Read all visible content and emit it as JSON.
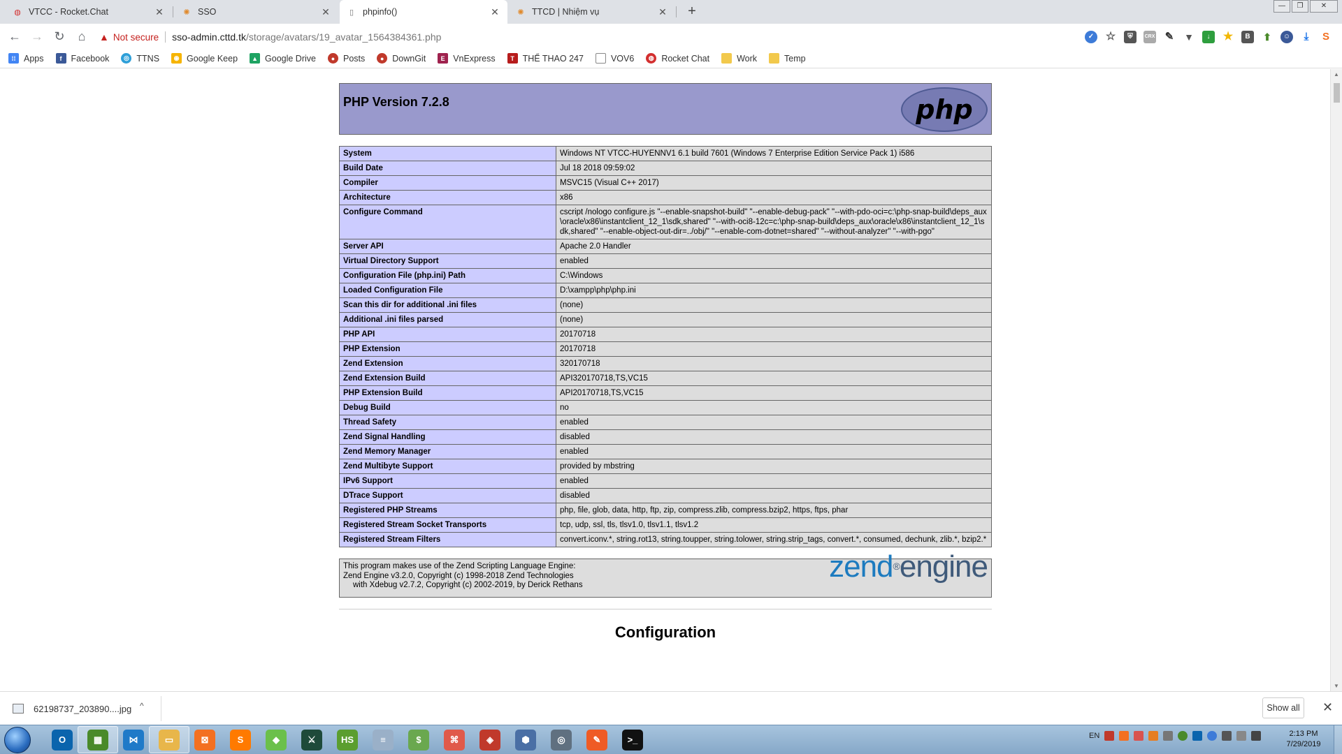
{
  "browser": {
    "tabs": [
      {
        "title": "VTCC - Rocket.Chat",
        "icon": "rocket-chat-icon",
        "active": false
      },
      {
        "title": "SSO",
        "icon": "sso-icon",
        "active": false
      },
      {
        "title": "phpinfo()",
        "icon": "page-icon",
        "active": true
      },
      {
        "title": "TTCD | Nhiệm vụ",
        "icon": "ttcd-icon",
        "active": false
      }
    ],
    "new_tab": "+",
    "window_controls": {
      "minimize": "—",
      "restore": "❐",
      "close": "✕"
    },
    "nav": {
      "back": "←",
      "forward": "→",
      "reload": "↻",
      "home": "⌂"
    },
    "address": {
      "security_label": "Not secure",
      "host": "sso-admin.cttd.tk",
      "path": "/storage/avatars/19_avatar_1564384361.php"
    },
    "extensions": [
      "lastpass-icon",
      "bookmark-star-icon",
      "shield-extension-icon",
      "crx-icon",
      "dropper-icon",
      "vpn-icon",
      "download-helper-icon",
      "star-extension-icon",
      "b-extension-icon",
      "arrow-up-extension-icon",
      "profile-avatar-icon",
      "downloads-icon",
      "menu-extension-icon"
    ],
    "bookmarks": [
      {
        "label": "Apps",
        "icon": "apps-grid-icon",
        "color": "#4285f4"
      },
      {
        "label": "Facebook",
        "icon": "facebook-icon",
        "color": "#3b5998"
      },
      {
        "label": "TTNS",
        "icon": "globe-icon",
        "color": "#2e9fd8"
      },
      {
        "label": "Google Keep",
        "icon": "google-keep-icon",
        "color": "#f6b400"
      },
      {
        "label": "Google Drive",
        "icon": "google-drive-icon",
        "color": "#1ea362"
      },
      {
        "label": "Posts",
        "icon": "posts-icon",
        "color": "#c0392b"
      },
      {
        "label": "DownGit",
        "icon": "downgit-icon",
        "color": "#c0392b"
      },
      {
        "label": "VnExpress",
        "icon": "vnexpress-icon",
        "color": "#9f224e"
      },
      {
        "label": "THỂ THAO 247",
        "icon": "thethao-icon",
        "color": "#b71c1c"
      },
      {
        "label": "VOV6",
        "icon": "page-icon",
        "color": "#888888"
      },
      {
        "label": "Rocket Chat",
        "icon": "rocket-chat-icon",
        "color": "#d32f2f"
      },
      {
        "label": "Work",
        "icon": "folder-icon",
        "color": "#f2c94c"
      },
      {
        "label": "Temp",
        "icon": "folder-icon",
        "color": "#f2c94c"
      }
    ]
  },
  "php": {
    "version_title": "PHP Version 7.2.8",
    "logo_text": "php",
    "rows": [
      {
        "k": "System",
        "v": "Windows NT VTCC-HUYENNV1 6.1 build 7601 (Windows 7 Enterprise Edition Service Pack 1) i586"
      },
      {
        "k": "Build Date",
        "v": "Jul 18 2018 09:59:02"
      },
      {
        "k": "Compiler",
        "v": "MSVC15 (Visual C++ 2017)"
      },
      {
        "k": "Architecture",
        "v": "x86"
      },
      {
        "k": "Configure Command",
        "v": "cscript /nologo configure.js \"--enable-snapshot-build\" \"--enable-debug-pack\" \"--with-pdo-oci=c:\\php-snap-build\\deps_aux\\oracle\\x86\\instantclient_12_1\\sdk,shared\" \"--with-oci8-12c=c:\\php-snap-build\\deps_aux\\oracle\\x86\\instantclient_12_1\\sdk,shared\" \"--enable-object-out-dir=../obj/\" \"--enable-com-dotnet=shared\" \"--without-analyzer\" \"--with-pgo\""
      },
      {
        "k": "Server API",
        "v": "Apache 2.0 Handler"
      },
      {
        "k": "Virtual Directory Support",
        "v": "enabled"
      },
      {
        "k": "Configuration File (php.ini) Path",
        "v": "C:\\Windows"
      },
      {
        "k": "Loaded Configuration File",
        "v": "D:\\xampp\\php\\php.ini"
      },
      {
        "k": "Scan this dir for additional .ini files",
        "v": "(none)"
      },
      {
        "k": "Additional .ini files parsed",
        "v": "(none)"
      },
      {
        "k": "PHP API",
        "v": "20170718"
      },
      {
        "k": "PHP Extension",
        "v": "20170718"
      },
      {
        "k": "Zend Extension",
        "v": "320170718"
      },
      {
        "k": "Zend Extension Build",
        "v": "API320170718,TS,VC15"
      },
      {
        "k": "PHP Extension Build",
        "v": "API20170718,TS,VC15"
      },
      {
        "k": "Debug Build",
        "v": "no"
      },
      {
        "k": "Thread Safety",
        "v": "enabled"
      },
      {
        "k": "Zend Signal Handling",
        "v": "disabled"
      },
      {
        "k": "Zend Memory Manager",
        "v": "enabled"
      },
      {
        "k": "Zend Multibyte Support",
        "v": "provided by mbstring"
      },
      {
        "k": "IPv6 Support",
        "v": "enabled"
      },
      {
        "k": "DTrace Support",
        "v": "disabled"
      },
      {
        "k": "Registered PHP Streams",
        "v": "php, file, glob, data, http, ftp, zip, compress.zlib, compress.bzip2, https, ftps, phar"
      },
      {
        "k": "Registered Stream Socket Transports",
        "v": "tcp, udp, ssl, tls, tlsv1.0, tlsv1.1, tlsv1.2"
      },
      {
        "k": "Registered Stream Filters",
        "v": "convert.iconv.*, string.rot13, string.toupper, string.tolower, string.strip_tags, convert.*, consumed, dechunk, zlib.*, bzip2.*"
      }
    ],
    "zend_line1": "This program makes use of the Zend Scripting Language Engine:",
    "zend_line2": "Zend Engine v3.2.0, Copyright (c) 1998-2018 Zend Technologies",
    "zend_line3": "with Xdebug v2.7.2, Copyright (c) 2002-2019, by Derick Rethans",
    "zend_logo_a": "zend",
    "zend_logo_b": "engine",
    "section_title": "Configuration"
  },
  "downloads": {
    "file": "62198737_203890....jpg",
    "chevron": "^",
    "show_all": "Show all",
    "close": "✕"
  },
  "taskbar": {
    "apps": [
      {
        "name": "outlook-icon",
        "color": "#0a64ad",
        "label": "O",
        "active": false
      },
      {
        "name": "chart-app-icon",
        "color": "#4a8a2a",
        "label": "▦",
        "active": true
      },
      {
        "name": "vscode-icon",
        "color": "#1f7ac8",
        "label": "⋈",
        "active": false
      },
      {
        "name": "explorer-icon",
        "color": "#e8b64a",
        "label": "▭",
        "active": true
      },
      {
        "name": "xampp-icon",
        "color": "#f37021",
        "label": "⊠",
        "active": false
      },
      {
        "name": "sublime-icon",
        "color": "#ff7a00",
        "label": "S",
        "active": false
      },
      {
        "name": "git-kraken-icon",
        "color": "#6bc04b",
        "label": "◆",
        "active": false
      },
      {
        "name": "gitkraken-icon",
        "color": "#1e4a3a",
        "label": "⚔",
        "active": false
      },
      {
        "name": "heidisql-icon",
        "color": "#5b9e2f",
        "label": "HS",
        "active": false
      },
      {
        "name": "database-icon",
        "color": "#9ab0c8",
        "label": "≡",
        "active": false
      },
      {
        "name": "money-icon",
        "color": "#6aa84f",
        "label": "$",
        "active": false
      },
      {
        "name": "swift-icon",
        "color": "#e05a4a",
        "label": "⌘",
        "active": false
      },
      {
        "name": "redis-icon",
        "color": "#c0392b",
        "label": "◈",
        "active": false
      },
      {
        "name": "virtualbox-icon",
        "color": "#4a6fa5",
        "label": "⬢",
        "active": false
      },
      {
        "name": "vpn-icon",
        "color": "#607080",
        "label": "◎",
        "active": false
      },
      {
        "name": "postman-icon",
        "color": "#ef5b25",
        "label": "✎",
        "active": false
      },
      {
        "name": "terminal-icon",
        "color": "#111111",
        "label": ">_",
        "active": false
      }
    ],
    "lang": "EN",
    "time": "2:13 PM",
    "date": "7/29/2019"
  }
}
